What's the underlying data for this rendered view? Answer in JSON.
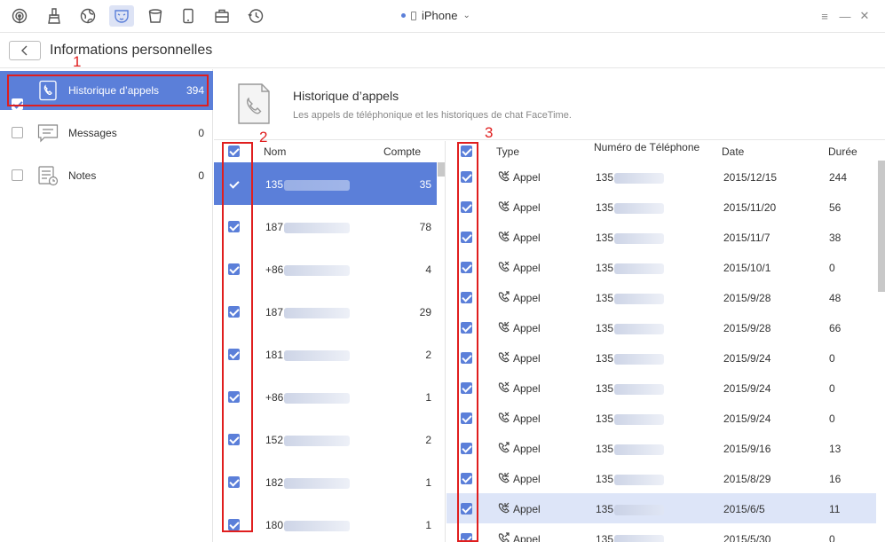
{
  "toolbar": {
    "icons": [
      "airdrop-icon",
      "cleaner-icon",
      "globe-icon",
      "mask-icon",
      "bucket-icon",
      "tablet-icon",
      "toolbox-icon",
      "history-icon"
    ],
    "active_index": 3
  },
  "device": {
    "name": "iPhone"
  },
  "window": {
    "menu": "≡",
    "minimize": "—",
    "close": "✕"
  },
  "header": {
    "title": "Informations personnelles"
  },
  "sidebar": {
    "items": [
      {
        "label": "Historique d’appels",
        "count": "394",
        "checked": true,
        "selected": true,
        "icon": "phone-icon"
      },
      {
        "label": "Messages",
        "count": "0",
        "checked": false,
        "selected": false,
        "icon": "message-icon"
      },
      {
        "label": "Notes",
        "count": "0",
        "checked": false,
        "selected": false,
        "icon": "notes-icon"
      }
    ]
  },
  "info": {
    "title": "Historique d’appels",
    "subtitle": "Les appels de téléphonique et les historiques de chat FaceTime."
  },
  "contacts": {
    "headers": {
      "name": "Nom",
      "count": "Compte"
    },
    "rows": [
      {
        "prefix": "135",
        "count": "35",
        "selected": true
      },
      {
        "prefix": "187",
        "count": "78"
      },
      {
        "prefix": "+86",
        "count": "4"
      },
      {
        "prefix": "187",
        "count": "29"
      },
      {
        "prefix": "181",
        "count": "2"
      },
      {
        "prefix": "+86",
        "count": "1"
      },
      {
        "prefix": "152",
        "count": "2"
      },
      {
        "prefix": "182",
        "count": "1"
      },
      {
        "prefix": "180",
        "count": "1"
      }
    ]
  },
  "calls": {
    "headers": {
      "type": "Type",
      "number": "Numéro de Téléphone",
      "date": "Date",
      "duration": "Durée"
    },
    "rows": [
      {
        "type": "Appel",
        "icon": "incoming-call-icon",
        "number": "135",
        "date": "2015/12/15",
        "duration": "244"
      },
      {
        "type": "Appel",
        "icon": "incoming-call-icon",
        "number": "135",
        "date": "2015/11/20",
        "duration": "56"
      },
      {
        "type": "Appel",
        "icon": "incoming-call-icon",
        "number": "135",
        "date": "2015/11/7",
        "duration": "38"
      },
      {
        "type": "Appel",
        "icon": "missed-call-icon",
        "number": "135",
        "date": "2015/10/1",
        "duration": "0"
      },
      {
        "type": "Appel",
        "icon": "outgoing-call-icon",
        "number": "135",
        "date": "2015/9/28",
        "duration": "48"
      },
      {
        "type": "Appel",
        "icon": "incoming-call-icon",
        "number": "135",
        "date": "2015/9/28",
        "duration": "66"
      },
      {
        "type": "Appel",
        "icon": "missed-call-icon",
        "number": "135",
        "date": "2015/9/24",
        "duration": "0"
      },
      {
        "type": "Appel",
        "icon": "missed-call-icon",
        "number": "135",
        "date": "2015/9/24",
        "duration": "0"
      },
      {
        "type": "Appel",
        "icon": "missed-call-icon",
        "number": "135",
        "date": "2015/9/24",
        "duration": "0"
      },
      {
        "type": "Appel",
        "icon": "outgoing-call-icon",
        "number": "135",
        "date": "2015/9/16",
        "duration": "13"
      },
      {
        "type": "Appel",
        "icon": "incoming-call-icon",
        "number": "135",
        "date": "2015/8/29",
        "duration": "16"
      },
      {
        "type": "Appel",
        "icon": "incoming-call-icon",
        "number": "135",
        "date": "2015/6/5",
        "duration": "11",
        "selected": true
      },
      {
        "type": "Appel",
        "icon": "outgoing-call-icon",
        "number": "135",
        "date": "2015/5/30",
        "duration": "0"
      }
    ]
  },
  "annotations": {
    "one": "1",
    "two": "2",
    "three": "3"
  },
  "colors": {
    "accent": "#5b7fd9",
    "annotation": "#e01e1e",
    "selected_row": "#dde5f8"
  }
}
